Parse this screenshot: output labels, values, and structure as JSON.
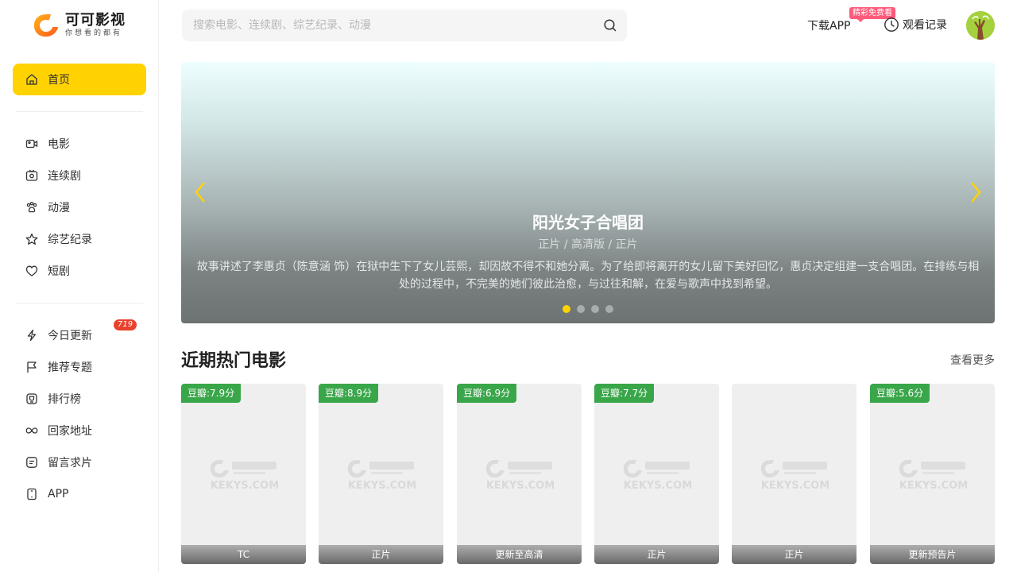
{
  "brand": {
    "name": "可可影视",
    "slogan": "你想看的都有",
    "accent": "#ffd200"
  },
  "sidebar": {
    "primary": [
      {
        "label": "首页",
        "icon": "home-icon",
        "active": true
      }
    ],
    "categories": [
      {
        "label": "电影",
        "icon": "video-camera-icon"
      },
      {
        "label": "连续剧",
        "icon": "tv-icon"
      },
      {
        "label": "动漫",
        "icon": "paw-icon"
      },
      {
        "label": "综艺纪录",
        "icon": "star-icon"
      },
      {
        "label": "短剧",
        "icon": "heart-icon"
      }
    ],
    "extras": [
      {
        "label": "今日更新",
        "icon": "lightning-icon",
        "badge": "719"
      },
      {
        "label": "推荐专题",
        "icon": "flag-icon"
      },
      {
        "label": "排行榜",
        "icon": "trophy-icon"
      },
      {
        "label": "回家地址",
        "icon": "infinity-link-icon"
      },
      {
        "label": "留言求片",
        "icon": "message-icon"
      },
      {
        "label": "APP",
        "icon": "mobile-phone-icon"
      }
    ]
  },
  "header": {
    "search_placeholder": "搜索电影、连续剧、综艺纪录、动漫",
    "download_label": "下载APP",
    "download_tag": "精彩免费看",
    "history_label": "观看记录"
  },
  "banner": {
    "title": "阳光女子合唱团",
    "meta": "正片 / 高清版 / 正片",
    "description": "故事讲述了李惠贞（陈意涵 饰）在狱中生下了女儿芸熙，却因故不得不和她分离。为了给即将离开的女儿留下美好回忆，惠贞决定组建一支合唱团。在排练与相处的过程中，不完美的她们彼此治愈，与过往和解，在爱与歌声中找到希望。",
    "slides": 4,
    "active_slide": 1
  },
  "section": {
    "title": "近期热门电影",
    "more_label": "查看更多",
    "watermark": "KEKYS.COM",
    "cards": [
      {
        "score": "豆瓣:7.9分",
        "status": "TC"
      },
      {
        "score": "豆瓣:8.9分",
        "status": "正片"
      },
      {
        "score": "豆瓣:6.9分",
        "status": "更新至高清"
      },
      {
        "score": "豆瓣:7.7分",
        "status": "正片"
      },
      {
        "score": "",
        "status": "正片"
      },
      {
        "score": "豆瓣:5.6分",
        "status": "更新预告片"
      }
    ]
  }
}
